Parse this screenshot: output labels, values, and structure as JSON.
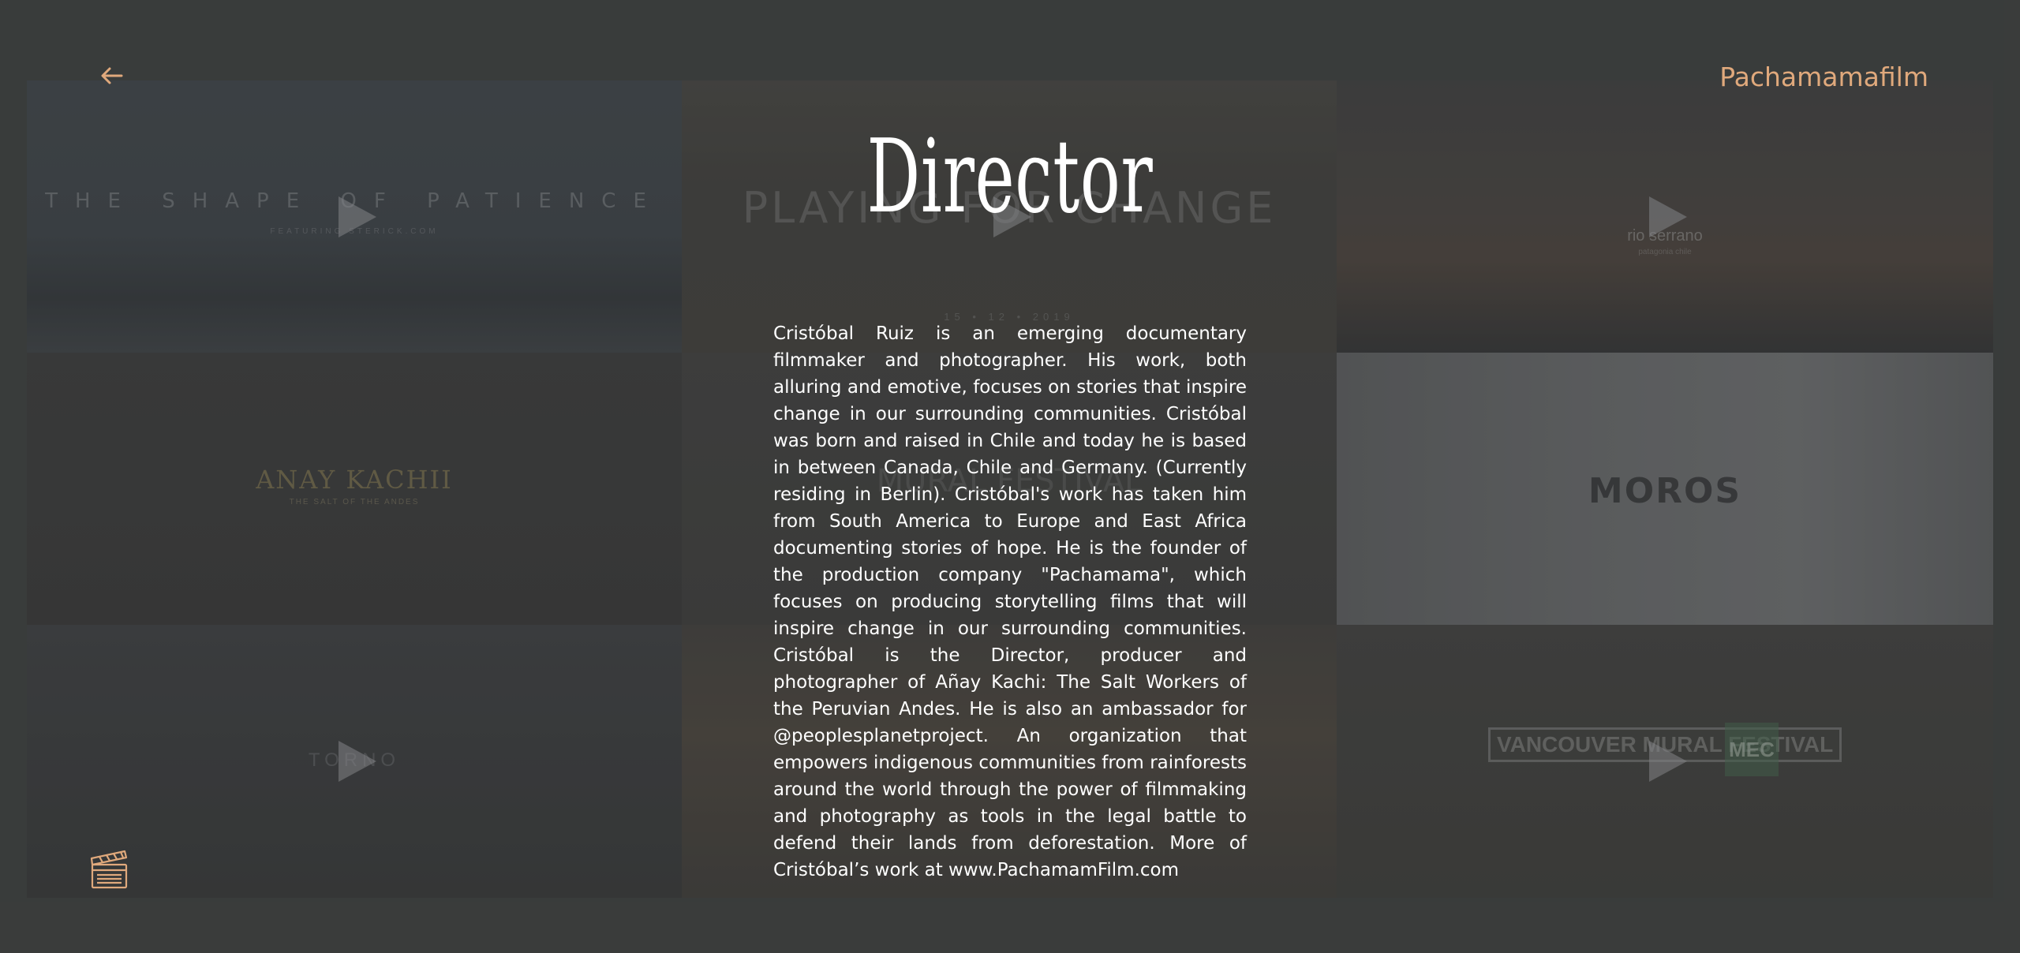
{
  "header": {
    "brand": "Pachamamafilm",
    "back_icon": "arrow-left-icon"
  },
  "main": {
    "title": "Director",
    "bio": "Cristóbal Ruiz is an emerging documentary filmmaker and photographer. His work, both alluring and emotive, focuses on stories that inspire change in our surrounding communities. Cristóbal was born and raised in Chile and today he is based in between Canada, Chile and Germany. (Currently residing in Berlin). Cristóbal's work has taken him from South America to Europe and East Africa documenting stories of hope. He is the founder of the production company \"Pachamama\", which focuses on producing storytelling films that will inspire change in our surrounding communities. Cristóbal is the Director, producer and photographer of Añay Kachi: The Salt Workers of the Peruvian Andes. He is also an ambassador for @peoplesplanetproject. An organization that empowers indigenous communities from rainforests around the world through the power of filmmaking and photography as tools in the legal battle to defend their lands from deforestation. More of Cristóbal’s work at www.PachamamFilm.com"
  },
  "videos": [
    {
      "title": "THE SHAPE OF PATIENCE",
      "subtitle": "FEATURING STERICK.COM"
    },
    {
      "title": "PLAYING FOR CHANGE",
      "date": "15 • 12 • 2019"
    },
    {
      "title": "rio serrano",
      "subtitle": "patagonia chile"
    },
    {
      "title": "ANAY KACHII",
      "subtitle": "THE SALT OF THE ANDES"
    },
    {
      "title": "MURAL FESTIVAL"
    },
    {
      "title": "MOROS"
    },
    {
      "title": "TORNO"
    },
    {
      "title": ""
    },
    {
      "title": "VANCOUVER MURAL FESTIVAL",
      "badge": "MEC"
    }
  ],
  "footer": {
    "clapper_icon": "clapperboard-icon"
  },
  "colors": {
    "accent": "#e0a97c",
    "background": "#3a3c3b",
    "text": "#ffffff"
  }
}
